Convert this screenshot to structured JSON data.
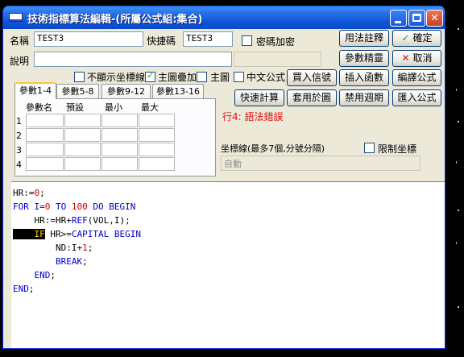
{
  "window": {
    "title": "技術指標算法編輯-(所屬公式組:集合)",
    "minimize": "minimize",
    "maximize": "maximize",
    "close": "close"
  },
  "form": {
    "name_label": "名稱",
    "name_value": "TEST3",
    "shortcut_label": "快捷碼",
    "shortcut_value": "TEST3",
    "password_label": "密碼加密",
    "desc_label": "說明",
    "desc_value": "",
    "desc2_value": "",
    "hide_axis_label": "不顯示坐標線",
    "main_overlay_label": "主圖疊加",
    "main_chart_label": "主圖",
    "chinese_formula_label": "中文公式"
  },
  "buttons": {
    "usage_notes": "用法註釋",
    "ok": "確定",
    "param_wizard": "參數精靈",
    "cancel": "取消",
    "buy_signal": "買入信號",
    "insert_function": "插入函數",
    "compile": "編譯公式",
    "quick_calc": "快速計算",
    "apply_to_chart": "套用於圖",
    "disabled_periods": "禁用週期",
    "import_formula": "匯入公式"
  },
  "tabs": [
    "參數1-4",
    "參數5-8",
    "參數9-12",
    "參數13-16"
  ],
  "params": {
    "headers": [
      "參數名",
      "預設",
      "最小",
      "最大"
    ],
    "rows": [
      "1",
      "2",
      "3",
      "4"
    ]
  },
  "status": {
    "error": "行4: 語法錯誤"
  },
  "axis": {
    "label": "坐標線(最多7個,分號分隔)",
    "limit_label": "限制坐標",
    "value": "自動"
  },
  "code": [
    [
      {
        "t": "HR:=",
        "c": "plain"
      },
      {
        "t": "0",
        "c": "num"
      },
      {
        "t": ";",
        "c": "plain"
      }
    ],
    [
      {
        "t": "FOR I=",
        "c": "kw"
      },
      {
        "t": "0",
        "c": "num"
      },
      {
        "t": " TO ",
        "c": "kw"
      },
      {
        "t": "100",
        "c": "num"
      },
      {
        "t": " DO BEGIN",
        "c": "kw"
      }
    ],
    [
      {
        "t": "    HR:=HR+",
        "c": "plain"
      },
      {
        "t": "REF",
        "c": "kw"
      },
      {
        "t": "(VOL,I);",
        "c": "plain"
      }
    ],
    [
      {
        "t": "  ",
        "c": "hl"
      },
      {
        "t": "  IF",
        "c": "hl"
      },
      {
        "t": " HR>=",
        "c": "plain"
      },
      {
        "t": "CAPITAL BEGIN",
        "c": "kw"
      }
    ],
    [
      {
        "t": "        ND:I+",
        "c": "plain"
      },
      {
        "t": "1",
        "c": "num"
      },
      {
        "t": ";",
        "c": "plain"
      }
    ],
    [
      {
        "t": "        BREAK",
        "c": "kw"
      },
      {
        "t": ";",
        "c": "plain"
      }
    ],
    [
      {
        "t": "    END",
        "c": "kw"
      },
      {
        "t": ";",
        "c": "plain"
      }
    ],
    [
      {
        "t": "END",
        "c": "kw"
      },
      {
        "t": ";",
        "c": "plain"
      }
    ]
  ]
}
